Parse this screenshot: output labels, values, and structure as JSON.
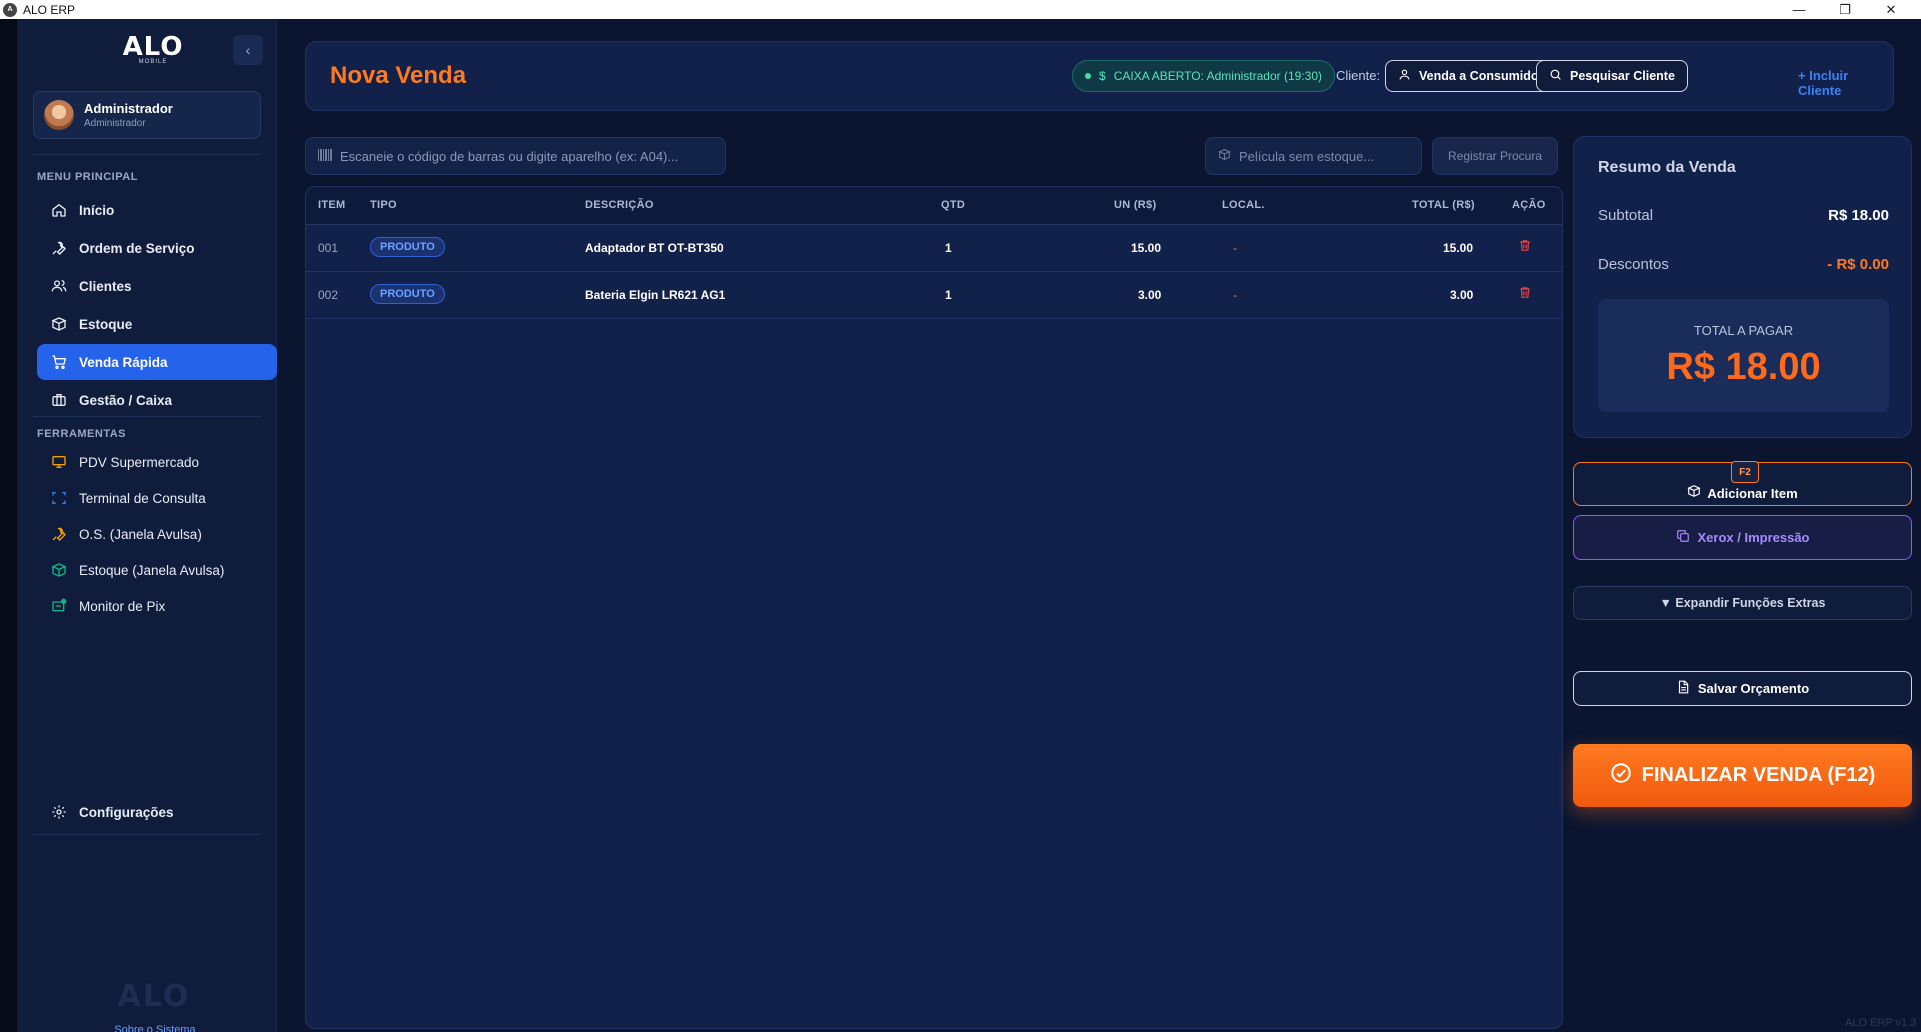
{
  "window": {
    "title": "ALO ERP",
    "minimize": "—",
    "restore": "❐",
    "close": "✕"
  },
  "sidebar": {
    "logo_text": "ALO",
    "logo_sub": "MOBILE",
    "collapse_glyph": "‹",
    "user": {
      "name": "Administrador",
      "role": "Administrador"
    },
    "menu_title": "MENU PRINCIPAL",
    "menu": [
      {
        "label": "Início",
        "icon": "home-icon"
      },
      {
        "label": "Ordem de Serviço",
        "icon": "wrench-icon"
      },
      {
        "label": "Clientes",
        "icon": "users-icon"
      },
      {
        "label": "Estoque",
        "icon": "package-icon"
      },
      {
        "label": "Venda Rápida",
        "icon": "cart-icon",
        "active": true
      },
      {
        "label": "Gestão / Caixa",
        "icon": "briefcase-icon"
      }
    ],
    "tools_title": "FERRAMENTAS",
    "tools": [
      {
        "label": "PDV Supermercado",
        "icon": "monitor-icon",
        "color": "#f59e0b"
      },
      {
        "label": "Terminal de Consulta",
        "icon": "scan-icon",
        "color": "#3b82f6"
      },
      {
        "label": "O.S. (Janela Avulsa)",
        "icon": "wrench-icon",
        "color": "#f59e0b"
      },
      {
        "label": "Estoque (Janela Avulsa)",
        "icon": "package-icon",
        "color": "#10b981"
      },
      {
        "label": "Monitor de Pix",
        "icon": "pix-monitor-icon",
        "color": "#10b981"
      }
    ],
    "settings_label": "Configurações",
    "about_label": "Sobre o Sistema"
  },
  "header": {
    "title": "Nova Venda",
    "caixa_status": "CAIXA ABERTO: Administrador (19:30)",
    "cliente_label": "Cliente:",
    "consumer_button": "Venda a Consumidor",
    "search_client_button": "Pesquisar Cliente",
    "include_client_link": "+ Incluir Cliente"
  },
  "scan": {
    "placeholder": "Escaneie o código de barras ou digite aparelho (ex: A04)..."
  },
  "pelicula": {
    "placeholder": "Película sem estoque..."
  },
  "register_button": "Registrar Procura",
  "table": {
    "headers": {
      "item": "ITEM",
      "tipo": "TIPO",
      "descricao": "DESCRIÇÃO",
      "qtd": "QTD",
      "un": "UN (R$)",
      "local": "LOCAL.",
      "total": "TOTAL (R$)",
      "acao": "AÇÃO"
    },
    "rows": [
      {
        "item": "001",
        "tipo": "PRODUTO",
        "descricao": "Adaptador BT OT-BT350",
        "qtd": "1",
        "un": "15.00",
        "local": "-",
        "total": "15.00"
      },
      {
        "item": "002",
        "tipo": "PRODUTO",
        "descricao": "Bateria Elgin LR621 AG1",
        "qtd": "1",
        "un": "3.00",
        "local": "-",
        "total": "3.00"
      }
    ]
  },
  "summary": {
    "title": "Resumo da Venda",
    "subtotal_label": "Subtotal",
    "subtotal_value": "R$ 18.00",
    "descontos_label": "Descontos",
    "descontos_value": "- R$ 0.00",
    "total_label": "TOTAL A PAGAR",
    "total_value": "R$ 18.00"
  },
  "actions": {
    "add_item_key": "F2",
    "add_item": "Adicionar Item",
    "xerox": "Xerox / Impressão",
    "expand": "▼ Expandir Funções Extras",
    "save_quote": "Salvar Orçamento",
    "finalize": "FINALIZAR VENDA (F12)"
  },
  "version": "ALO ERP v1.3",
  "colors": {
    "accent": "#ff7a1f",
    "primary": "#2563eb",
    "background": "#0b1530",
    "panel": "#12214a"
  }
}
